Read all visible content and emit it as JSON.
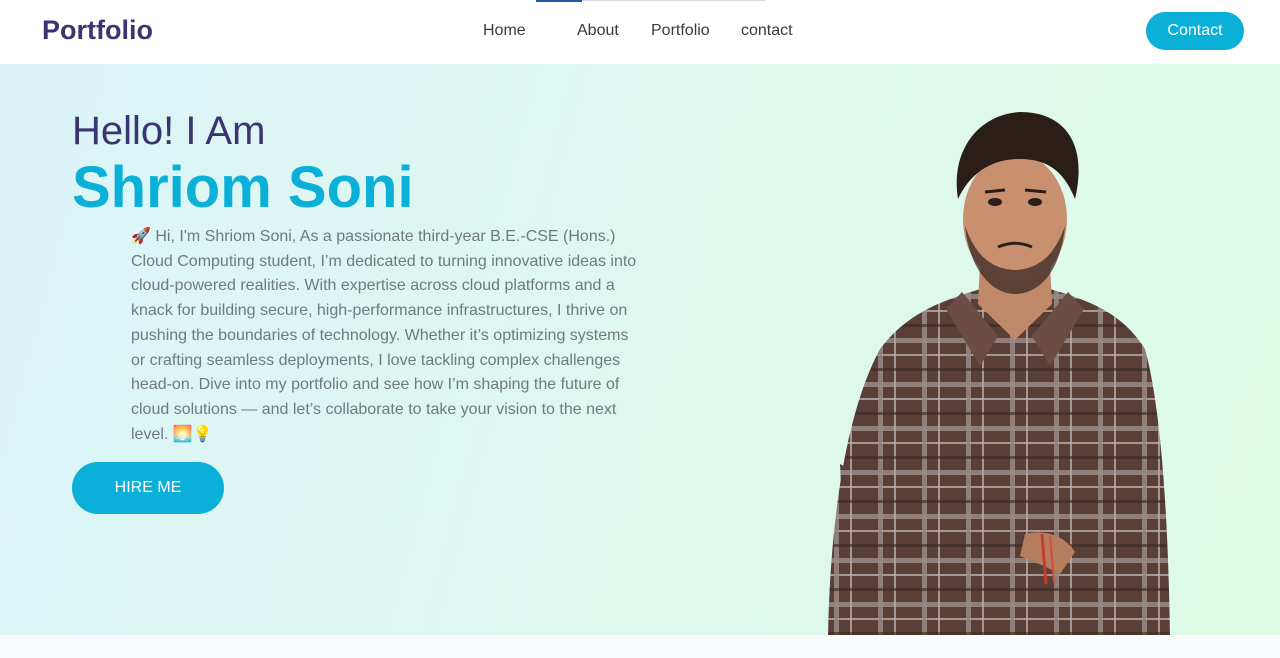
{
  "header": {
    "brand": "Portfolio",
    "nav": [
      "Home",
      "About",
      "Portfolio",
      "contact"
    ],
    "active_nav": "Home",
    "cta_label": "Contact"
  },
  "hero": {
    "greeting": "Hello! I Am",
    "name": "Shriom Soni",
    "bio_emoji_start": "🚀",
    "bio": "Hi, I'm Shriom Soni, As a passionate third-year B.E.-CSE (Hons.) Cloud Computing student, I’m dedicated to turning innovative ideas into cloud-powered realities. With expertise across cloud platforms and a knack for building secure, high-performance infrastructures, I thrive on pushing the boundaries of technology. Whether it’s optimizing systems or crafting seamless deployments, I love tackling complex challenges head-on. Dive into my portfolio and see how I’m shaping the future of cloud solutions — and let’s collaborate to take your vision to the next level.",
    "bio_emoji_end": "🌅💡",
    "hire_label": "HIRE ME"
  },
  "colors": {
    "brand": "#3a3570",
    "accent": "#0ab0d8",
    "text_muted": "#6f7a80"
  }
}
